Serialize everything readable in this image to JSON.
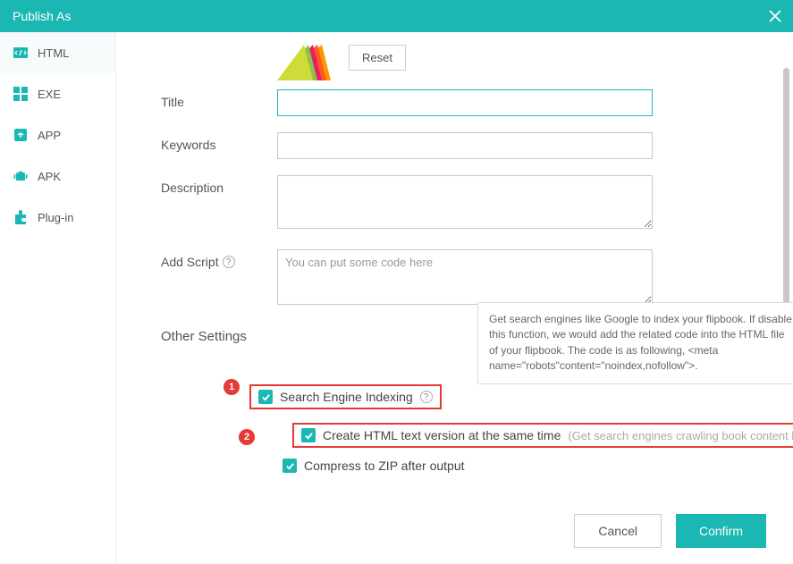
{
  "window": {
    "title": "Publish As"
  },
  "sidebar": {
    "items": [
      {
        "label": "HTML"
      },
      {
        "label": "EXE"
      },
      {
        "label": "APP"
      },
      {
        "label": "APK"
      },
      {
        "label": "Plug-in"
      }
    ]
  },
  "reset_label": "Reset",
  "form": {
    "title_label": "Title",
    "keywords_label": "Keywords",
    "description_label": "Description",
    "addscript_label": "Add Script",
    "addscript_placeholder": "You can put some code here"
  },
  "tooltip_text": "Get search engines like Google to index your flipbook. If disable this function, we would add the related code into the HTML file of your flipbook. The code is as following, <meta name=\"robots\"content=\"noindex,nofollow\">.",
  "other_settings_title": "Other Settings",
  "badges": {
    "one": "1",
    "two": "2"
  },
  "checks": {
    "sei": "Search Engine Indexing",
    "html_text": "Create HTML text version at the same time",
    "html_text_hint": "(Get search engines crawling book content better)",
    "zip": "Compress to ZIP after output"
  },
  "footer": {
    "cancel": "Cancel",
    "confirm": "Confirm"
  }
}
